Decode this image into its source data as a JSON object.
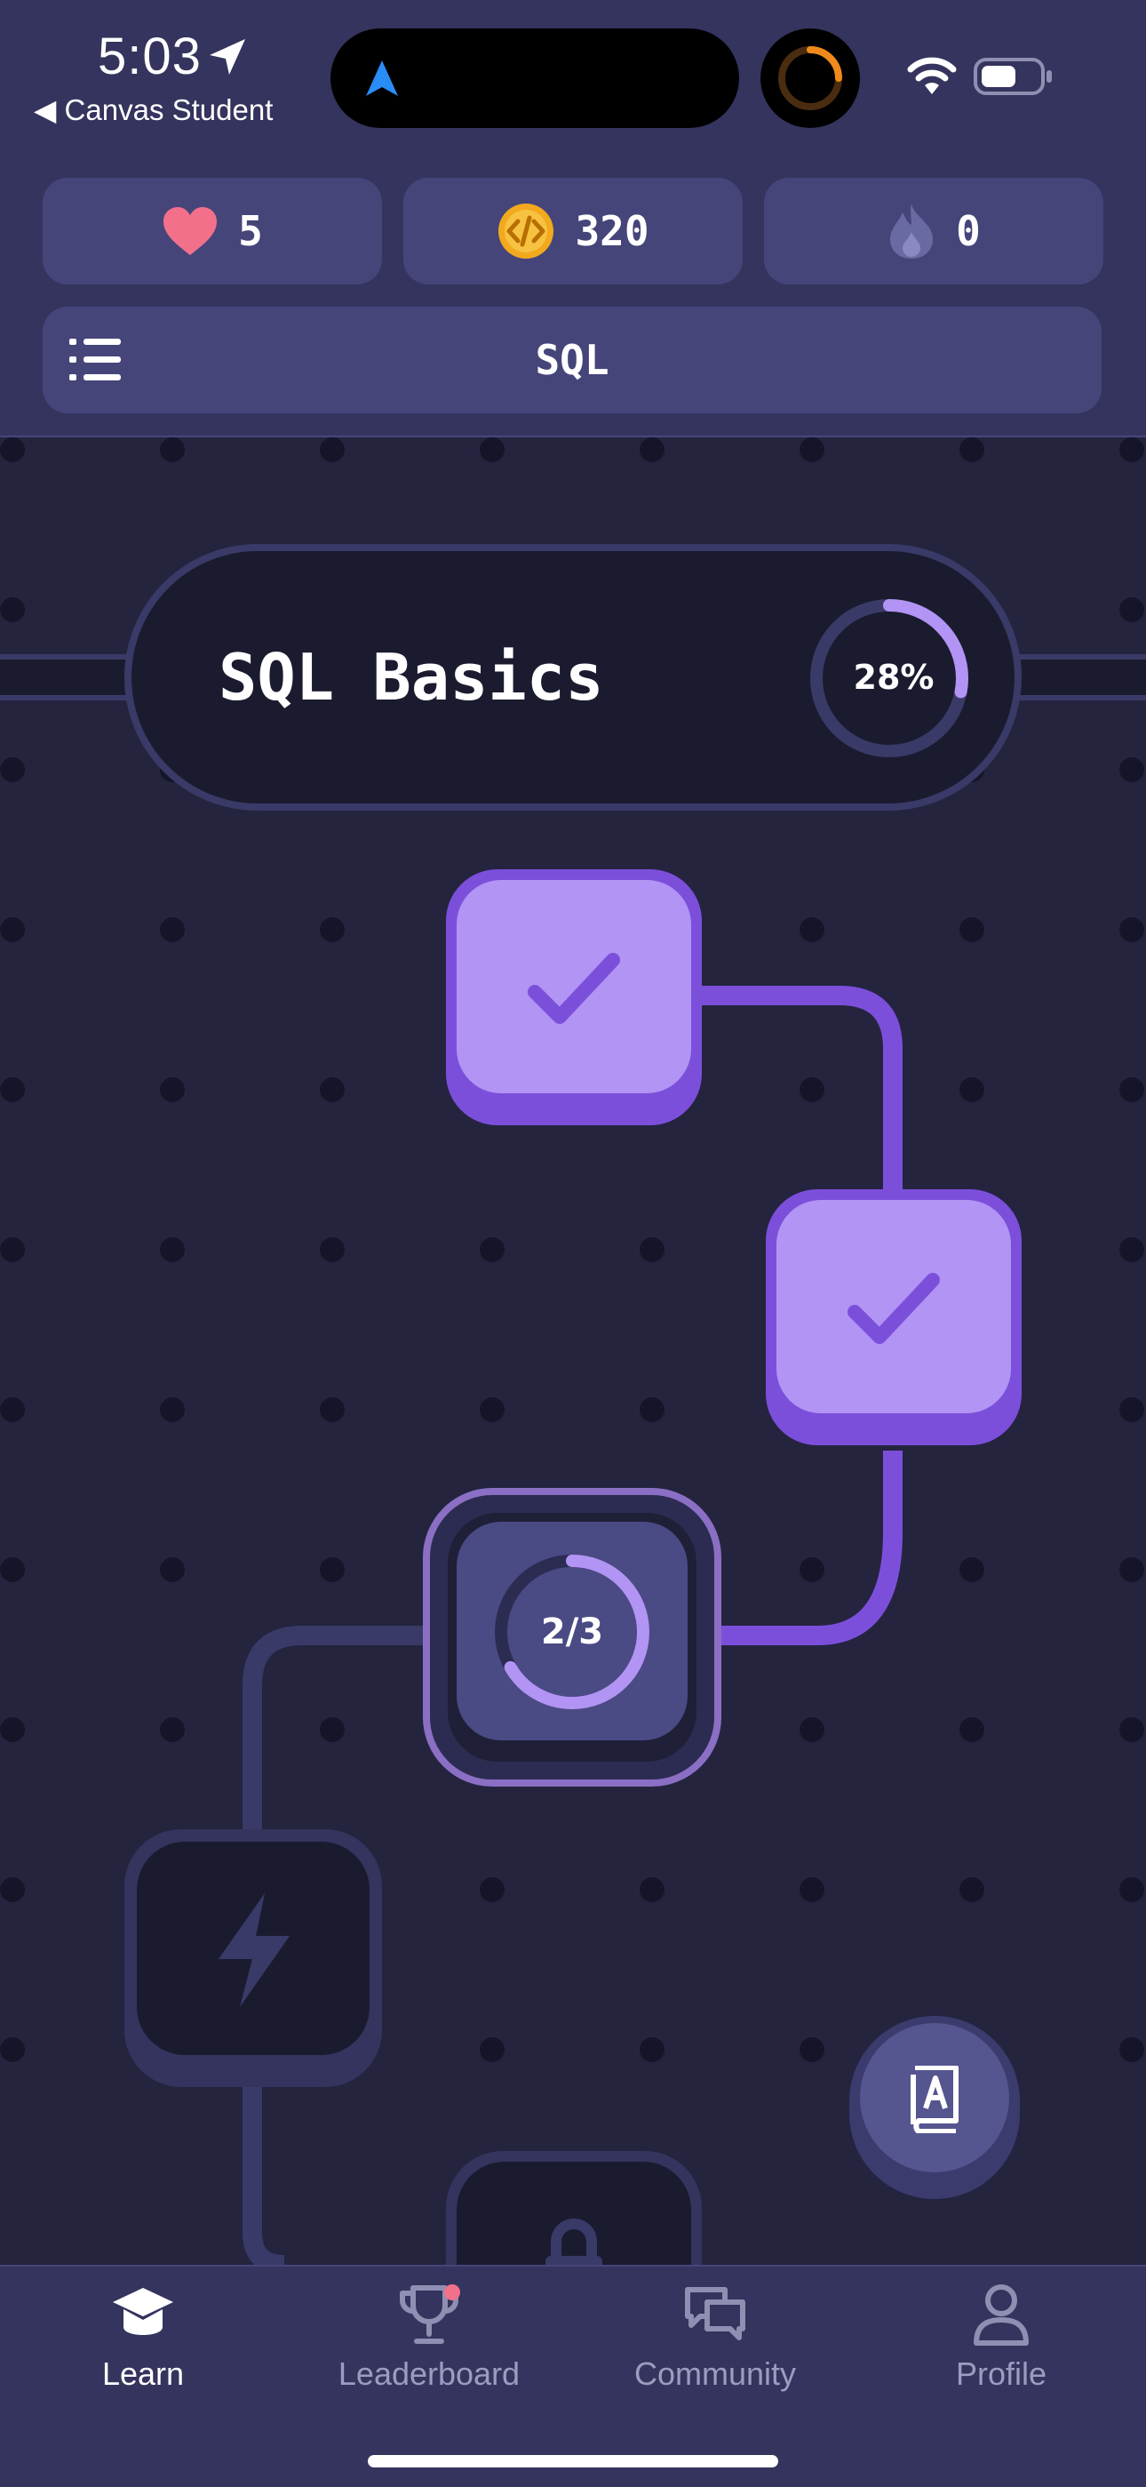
{
  "status_bar": {
    "time": "5:03",
    "back_app": "◀ Canvas Student"
  },
  "stats": {
    "hearts": "5",
    "coins": "320",
    "streak": "0"
  },
  "course": {
    "title": "SQL"
  },
  "unit": {
    "title": "SQL Basics",
    "progress_label": "28%",
    "progress": 0.28
  },
  "lessons": [
    {
      "state": "completed"
    },
    {
      "state": "completed"
    },
    {
      "state": "in-progress",
      "progress_label": "2/3",
      "progress": 0.6667
    },
    {
      "state": "locked-challenge"
    },
    {
      "state": "locked"
    }
  ],
  "nav": {
    "items": [
      {
        "label": "Learn",
        "icon": "graduation-cap-icon",
        "active": true
      },
      {
        "label": "Leaderboard",
        "icon": "trophy-icon",
        "badge": true
      },
      {
        "label": "Community",
        "icon": "chat-bubbles-icon"
      },
      {
        "label": "Profile",
        "icon": "person-icon"
      }
    ]
  },
  "colors": {
    "accent": "#7c4fdb",
    "completed_tile": "#b294f4",
    "background": "#24243f",
    "header": "#34345e",
    "heart": "#f2708a",
    "coin": "#f2a91d",
    "badge": "#f2708a"
  }
}
